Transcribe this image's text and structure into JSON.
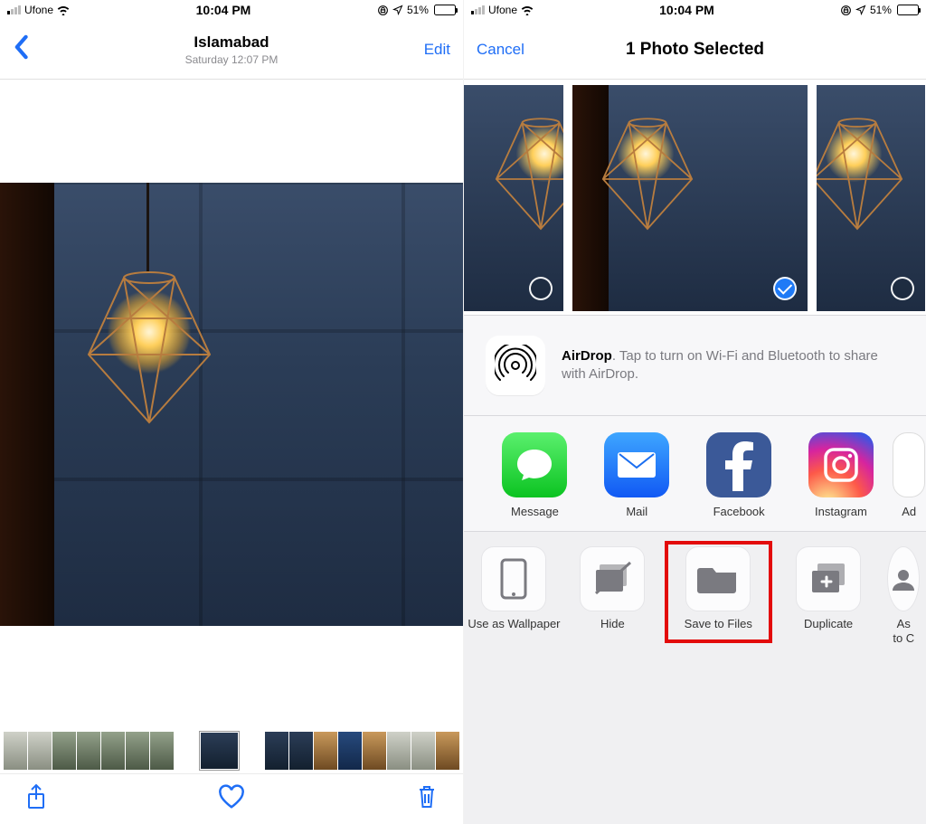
{
  "statusBar": {
    "carrier": "Ufone",
    "time": "10:04 PM",
    "batteryPercent": "51%"
  },
  "photoView": {
    "backLabel": "",
    "title": "Islamabad",
    "subtitle": "Saturday 12:07 PM",
    "editLabel": "Edit"
  },
  "shareSheet": {
    "cancelLabel": "Cancel",
    "title": "1 Photo Selected",
    "airdrop": {
      "name": "AirDrop",
      "hint": ". Tap to turn on Wi-Fi and Bluetooth to share with AirDrop."
    },
    "apps": [
      {
        "label": "Message"
      },
      {
        "label": "Mail"
      },
      {
        "label": "Facebook"
      },
      {
        "label": "Instagram"
      },
      {
        "label": "Ad"
      }
    ],
    "actions": [
      {
        "label": "Use as Wallpaper"
      },
      {
        "label": "Hide"
      },
      {
        "label": "Save to Files"
      },
      {
        "label": "Duplicate"
      },
      {
        "label": "Assign to Contact"
      }
    ],
    "actionsShort": {
      "assign1": "As",
      "assign2": "to C"
    }
  }
}
